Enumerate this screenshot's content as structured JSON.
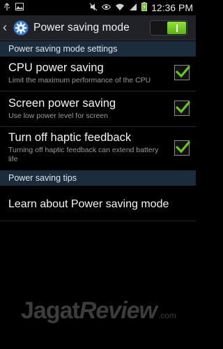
{
  "status_bar": {
    "time": "12:36 PM",
    "left_icons": [
      "usb-icon",
      "image-icon"
    ],
    "right_icons": [
      "mute-icon",
      "eye-icon",
      "wifi-icon",
      "signal-icon",
      "battery-icon"
    ]
  },
  "header": {
    "title": "Power saving mode",
    "master_switch_on": true
  },
  "sections": {
    "settings_header": "Power saving mode settings",
    "tips_header": "Power saving tips"
  },
  "settings": [
    {
      "title": "CPU power saving",
      "summary": "Limit the maximum performance of the CPU",
      "checked": true
    },
    {
      "title": "Screen power saving",
      "summary": "Use low power level for screen",
      "checked": true
    },
    {
      "title": "Turn off haptic feedback",
      "summary": "Turning off haptic feedback can extend battery life",
      "checked": true
    }
  ],
  "tips": {
    "learn_label": "Learn about Power saving mode"
  },
  "watermark": {
    "part1": "Jagat",
    "part2": "Review",
    "part3": ".com"
  },
  "colors": {
    "accent_green": "#6cc51f",
    "section_bg": "#1b2c3d"
  }
}
